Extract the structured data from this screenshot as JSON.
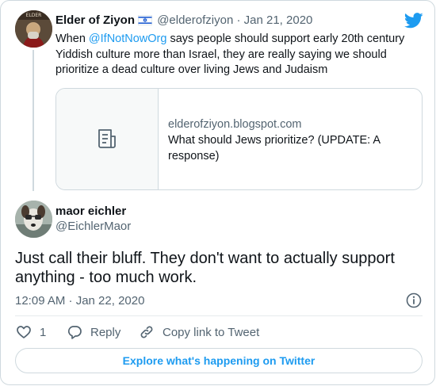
{
  "parent_tweet": {
    "avatar_icon": "profile-avatar-elder-of-ziyon",
    "display_name": "Elder of Ziyon",
    "flag_icon": "israel-flag-icon",
    "handle": "@elderofziyon",
    "separator": "·",
    "date": "Jan 21, 2020",
    "text_before_mention": "When ",
    "mention": "@IfNotNowOrg",
    "text_after_mention": " says people should support early 20th century Yiddish culture more than Israel, they are really saying we should prioritize a dead culture over living Jews and Judaism",
    "link_card": {
      "icon": "document-icon",
      "domain": "elderofziyon.blogspot.com",
      "title": "What should Jews prioritize? (UPDATE: A response)"
    }
  },
  "reply_tweet": {
    "avatar_icon": "profile-avatar-dog",
    "display_name": "maor eichler",
    "handle": "@EichlerMaor",
    "text": "Just call their bluff. They don't want to actually support anything - too much work.",
    "timestamp": "12:09 AM · Jan 22, 2020"
  },
  "actions": {
    "like_count": "1",
    "reply_label": "Reply",
    "copy_label": "Copy link to Tweet"
  },
  "explore_label": "Explore what's happening on Twitter",
  "colors": {
    "accent": "#1d9bf0",
    "text": "#0f1419",
    "muted": "#536471",
    "border": "#cfd9de"
  }
}
